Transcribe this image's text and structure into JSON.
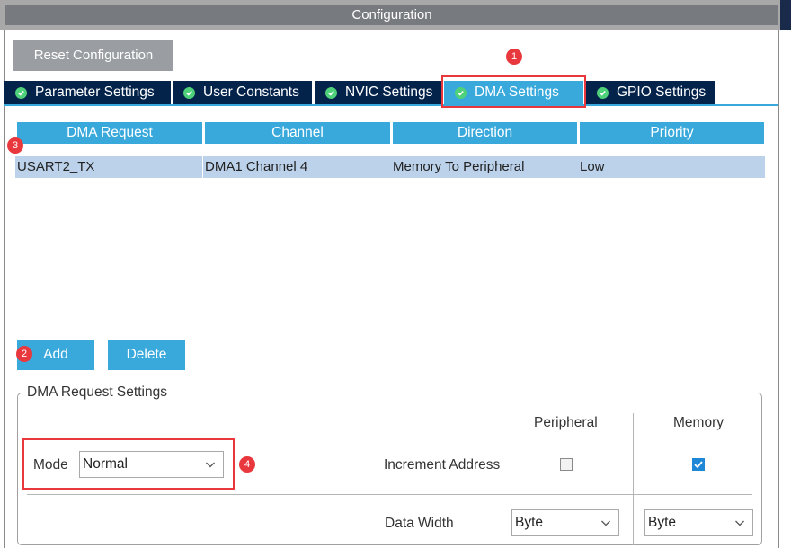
{
  "window": {
    "title": "Configuration"
  },
  "toolbar": {
    "reset_label": "Reset Configuration"
  },
  "tabs": [
    {
      "label": "Parameter Settings",
      "active": false
    },
    {
      "label": "User Constants",
      "active": false
    },
    {
      "label": "NVIC Settings",
      "active": false
    },
    {
      "label": "DMA Settings",
      "active": true
    },
    {
      "label": "GPIO Settings",
      "active": false
    }
  ],
  "table": {
    "headers": [
      "DMA Request",
      "Channel",
      "Direction",
      "Priority"
    ],
    "rows": [
      [
        "USART2_TX",
        "DMA1 Channel 4",
        "Memory To Peripheral",
        "Low"
      ]
    ]
  },
  "actions": {
    "add_label": "Add",
    "delete_label": "Delete"
  },
  "annotations": {
    "b1": "1",
    "b2": "2",
    "b3": "3",
    "b4": "4"
  },
  "settings": {
    "legend": "DMA Request Settings",
    "peripheral_header": "Peripheral",
    "memory_header": "Memory",
    "mode_label": "Mode",
    "mode_value": "Normal",
    "increment_label": "Increment Address",
    "peripheral_increment": false,
    "memory_increment": true,
    "data_width_label": "Data Width",
    "peripheral_width": "Byte",
    "memory_width": "Byte"
  },
  "colors": {
    "accent": "#39a9dc",
    "tab_bg": "#03234b",
    "highlight": "#e8383d",
    "row_bg": "#bcd2ea"
  }
}
